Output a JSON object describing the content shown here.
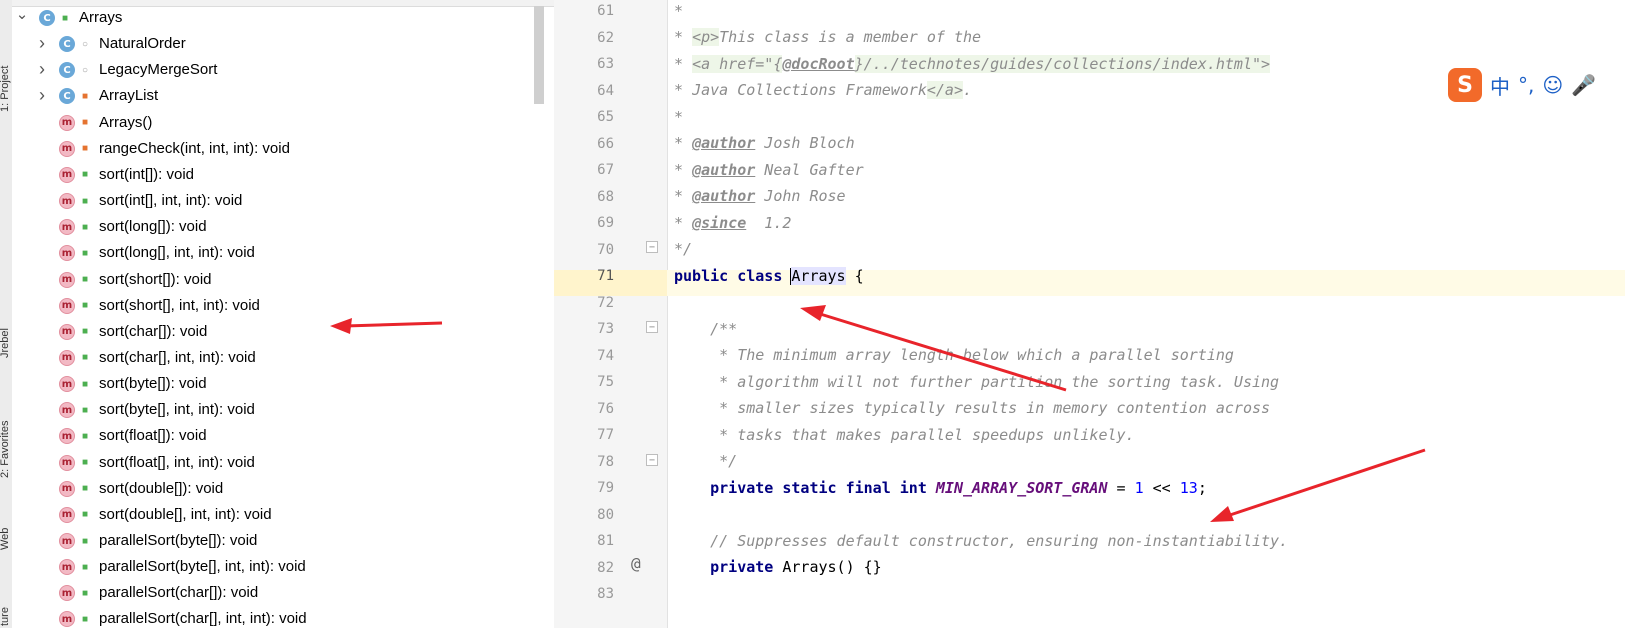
{
  "toolstrip": {
    "tabs": [
      "1: Project",
      "Jrebel",
      "2: Favorites",
      "Web",
      "ture"
    ]
  },
  "structure": {
    "items": [
      {
        "label": "Arrays",
        "kind": "class",
        "kind_letter": "C",
        "visibility": "public",
        "expandable": true,
        "expanded": true,
        "level": 0
      },
      {
        "label": "NaturalOrder",
        "kind": "class",
        "kind_letter": "C",
        "visibility": "package",
        "expandable": true,
        "expanded": false,
        "level": 1
      },
      {
        "label": "LegacyMergeSort",
        "kind": "class",
        "kind_letter": "C",
        "visibility": "package",
        "expandable": true,
        "expanded": false,
        "level": 1
      },
      {
        "label": "ArrayList",
        "kind": "class",
        "kind_letter": "C",
        "visibility": "private",
        "expandable": true,
        "expanded": false,
        "level": 1
      },
      {
        "label": "Arrays()",
        "kind": "method",
        "kind_letter": "m",
        "visibility": "private",
        "expandable": false,
        "level": 1
      },
      {
        "label": "rangeCheck(int, int, int): void",
        "kind": "method",
        "kind_letter": "m",
        "visibility": "private",
        "expandable": false,
        "level": 1
      },
      {
        "label": "sort(int[]): void",
        "kind": "method",
        "kind_letter": "m",
        "visibility": "public",
        "expandable": false,
        "level": 1
      },
      {
        "label": "sort(int[], int, int): void",
        "kind": "method",
        "kind_letter": "m",
        "visibility": "public",
        "expandable": false,
        "level": 1
      },
      {
        "label": "sort(long[]): void",
        "kind": "method",
        "kind_letter": "m",
        "visibility": "public",
        "expandable": false,
        "level": 1
      },
      {
        "label": "sort(long[], int, int): void",
        "kind": "method",
        "kind_letter": "m",
        "visibility": "public",
        "expandable": false,
        "level": 1
      },
      {
        "label": "sort(short[]): void",
        "kind": "method",
        "kind_letter": "m",
        "visibility": "public",
        "expandable": false,
        "level": 1
      },
      {
        "label": "sort(short[], int, int): void",
        "kind": "method",
        "kind_letter": "m",
        "visibility": "public",
        "expandable": false,
        "level": 1
      },
      {
        "label": "sort(char[]): void",
        "kind": "method",
        "kind_letter": "m",
        "visibility": "public",
        "expandable": false,
        "level": 1
      },
      {
        "label": "sort(char[], int, int): void",
        "kind": "method",
        "kind_letter": "m",
        "visibility": "public",
        "expandable": false,
        "level": 1
      },
      {
        "label": "sort(byte[]): void",
        "kind": "method",
        "kind_letter": "m",
        "visibility": "public",
        "expandable": false,
        "level": 1
      },
      {
        "label": "sort(byte[], int, int): void",
        "kind": "method",
        "kind_letter": "m",
        "visibility": "public",
        "expandable": false,
        "level": 1
      },
      {
        "label": "sort(float[]): void",
        "kind": "method",
        "kind_letter": "m",
        "visibility": "public",
        "expandable": false,
        "level": 1
      },
      {
        "label": "sort(float[], int, int): void",
        "kind": "method",
        "kind_letter": "m",
        "visibility": "public",
        "expandable": false,
        "level": 1
      },
      {
        "label": "sort(double[]): void",
        "kind": "method",
        "kind_letter": "m",
        "visibility": "public",
        "expandable": false,
        "level": 1
      },
      {
        "label": "sort(double[], int, int): void",
        "kind": "method",
        "kind_letter": "m",
        "visibility": "public",
        "expandable": false,
        "level": 1
      },
      {
        "label": "parallelSort(byte[]): void",
        "kind": "method",
        "kind_letter": "m",
        "visibility": "public",
        "expandable": false,
        "level": 1
      },
      {
        "label": "parallelSort(byte[], int, int): void",
        "kind": "method",
        "kind_letter": "m",
        "visibility": "public",
        "expandable": false,
        "level": 1
      },
      {
        "label": "parallelSort(char[]): void",
        "kind": "method",
        "kind_letter": "m",
        "visibility": "public",
        "expandable": false,
        "level": 1
      },
      {
        "label": "parallelSort(char[], int, int): void",
        "kind": "method",
        "kind_letter": "m",
        "visibility": "public",
        "expandable": false,
        "level": 1
      }
    ]
  },
  "editor": {
    "line_numbers": [
      "61",
      "62",
      "63",
      "64",
      "65",
      "66",
      "67",
      "68",
      "69",
      "70",
      "71",
      "72",
      "73",
      "74",
      "75",
      "76",
      "77",
      "78",
      "79",
      "80",
      "81",
      "82",
      "83"
    ],
    "current_line": "71",
    "gutter_marker_symbol": "@",
    "fold_marker_symbol": "−",
    "code": {
      "l61": "*",
      "l62_star": "* ",
      "l62_tag": "<p>",
      "l62_text": "This class is a member of the",
      "l63_star": "* ",
      "l63_tag_open": "<a href=\"{",
      "l63_doctag": "@docRoot",
      "l63_attr": "}/../technotes/guides/collections/index.html\">",
      "l64_star": "* ",
      "l64_text": "Java Collections Framework",
      "l64_tag": "</a>",
      "l64_end": ".",
      "l65": "*",
      "l66_star": "* ",
      "l66_tag": "@author",
      "l66_text": " Josh Bloch",
      "l67_star": "* ",
      "l67_tag": "@author",
      "l67_text": " Neal Gafter",
      "l68_star": "* ",
      "l68_tag": "@author",
      "l68_text": " John Rose",
      "l69_star": "* ",
      "l69_tag": "@since",
      "l69_text": "  1.2",
      "l70": "*/",
      "l71_kw": "public class ",
      "l71_name": "Arrays",
      "l71_rest": " {",
      "l73": "    /**",
      "l74": "     * The minimum array length below which a parallel sorting",
      "l75": "     * algorithm will not further partition the sorting task. Using",
      "l76": "     * smaller sizes typically results in memory contention across",
      "l77": "     * tasks that makes parallel speedups unlikely.",
      "l78": "     */",
      "l79_indent": "    ",
      "l79_kw": "private static final int ",
      "l79_field": "MIN_ARRAY_SORT_GRAN",
      "l79_eq": " = ",
      "l79_n1": "1",
      "l79_op": " << ",
      "l79_n2": "13",
      "l79_end": ";",
      "l81": "    // Suppresses default constructor, ensuring non-instantiability.",
      "l82_indent": "    ",
      "l82_kw": "private ",
      "l82_rest": "Arrays() {}"
    }
  },
  "ime": {
    "logo": "S",
    "items": [
      "中",
      "°,",
      "☺",
      "🎤"
    ]
  },
  "colors": {
    "annotation_arrow": "#e8242b",
    "keyword": "#000080",
    "comment": "#8c8c8c",
    "field": "#660e7a",
    "number": "#0000ff",
    "current_line": "#fffbe6"
  }
}
